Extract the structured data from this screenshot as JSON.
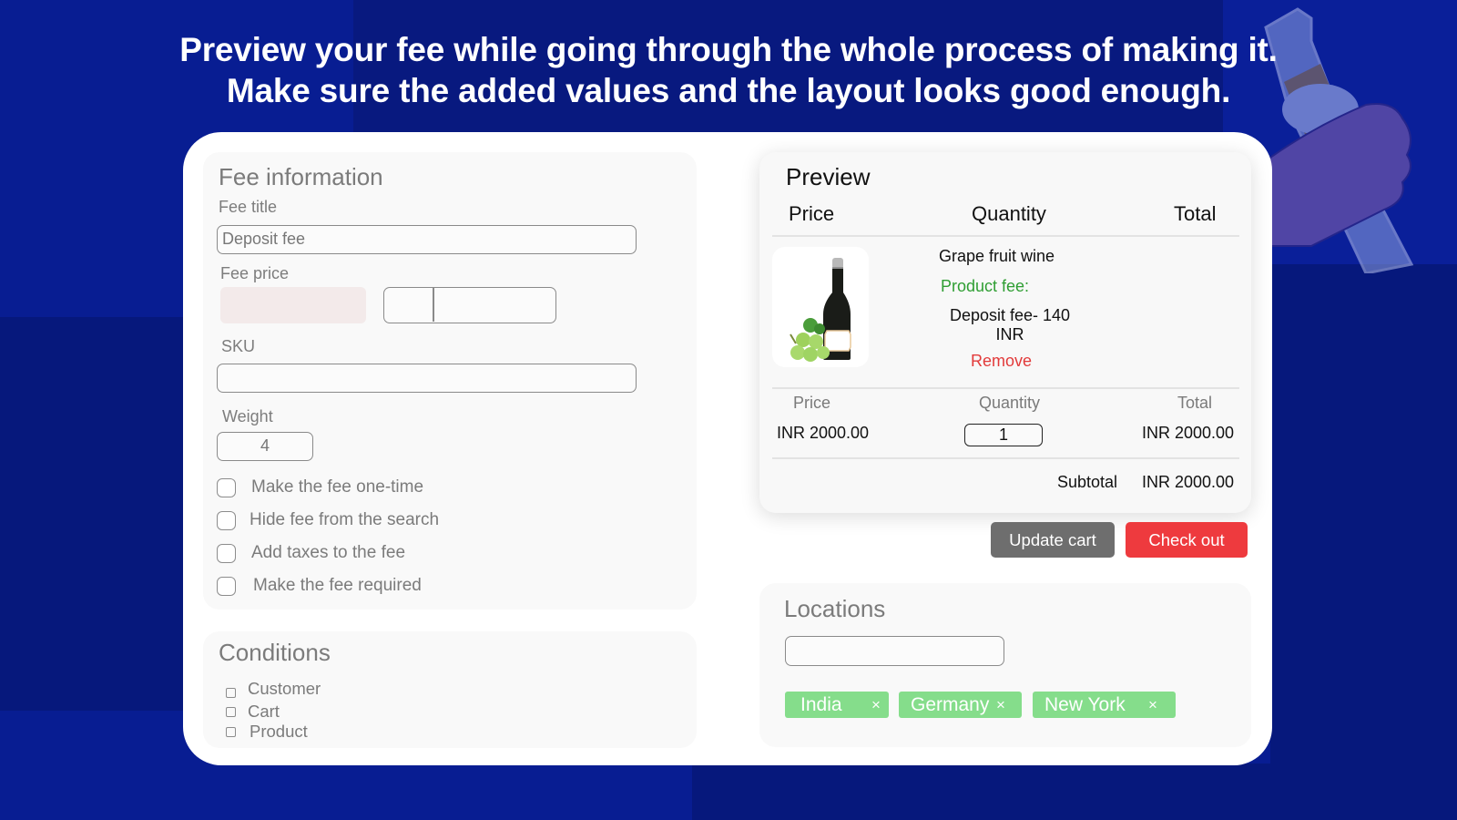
{
  "headline": {
    "line1": "Preview your fee while going through the whole process of making it.",
    "line2": "Make sure the added values and the layout looks good enough."
  },
  "fee_information": {
    "title": "Fee information",
    "fee_title": {
      "label": "Fee title",
      "value": "Deposit fee"
    },
    "fee_price": {
      "label": "Fee price",
      "value": ""
    },
    "sku": {
      "label": "SKU",
      "value": ""
    },
    "weight": {
      "label": "Weight",
      "value": "4"
    },
    "options": [
      {
        "label": "Make the fee one-time",
        "checked": false
      },
      {
        "label": "Hide fee from the search",
        "checked": false
      },
      {
        "label": "Add taxes to the fee",
        "checked": false
      },
      {
        "label": "Make the fee required",
        "checked": false
      }
    ]
  },
  "conditions": {
    "title": "Conditions",
    "items": [
      {
        "label": "Customer",
        "checked": false
      },
      {
        "label": "Cart",
        "checked": false
      },
      {
        "label": "Product",
        "checked": false
      }
    ]
  },
  "preview": {
    "title": "Preview",
    "headers": {
      "price": "Price",
      "quantity": "Quantity",
      "total": "Total"
    },
    "product": {
      "image_icon": "wine-bottle-with-grapes",
      "name": "Grape fruit wine",
      "fee_label": "Product fee:",
      "fee_line1": "Deposit fee- 140",
      "fee_line2": "INR",
      "remove_label": "Remove"
    },
    "line": {
      "price_label": "Price",
      "quantity_label": "Quantity",
      "total_label": "Total",
      "price": "INR 2000.00",
      "quantity": "1",
      "total": "INR 2000.00"
    },
    "subtotal_label": "Subtotal",
    "subtotal": "INR 2000.00"
  },
  "actions": {
    "update_cart": "Update cart",
    "check_out": "Check out"
  },
  "locations": {
    "title": "Locations",
    "input_value": "",
    "tags": [
      {
        "label": "India",
        "remove": "×"
      },
      {
        "label": "Germany",
        "remove": "×"
      },
      {
        "label": "New York",
        "remove": "×"
      }
    ]
  },
  "colors": {
    "background": "#081d92",
    "checkout": "#ee3a3e",
    "update_cart": "#6e6e6e",
    "tag": "#85dd8b",
    "product_fee": "#2f9e33",
    "remove": "#e23a3a"
  }
}
